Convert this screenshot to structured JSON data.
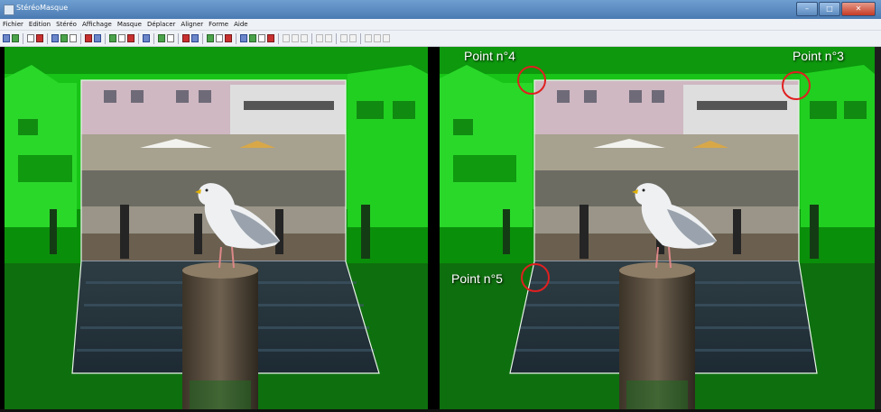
{
  "window": {
    "title": "StéréoMasque",
    "controls": {
      "minimize": "–",
      "maximize": "□",
      "close": "✕"
    }
  },
  "menu": [
    "Fichier",
    "Edition",
    "Stéréo",
    "Affichage",
    "Masque",
    "Déplacer",
    "Aligner",
    "Forme",
    "Aide"
  ],
  "toolbar_icons": [
    "open-icon",
    "save-icon",
    "sep",
    "compare-icon",
    "swap-icon",
    "sep",
    "info-icon",
    "undo-icon",
    "redo-icon",
    "sep",
    "crop-icon",
    "grid-icon",
    "sep",
    "move-icon",
    "scale-icon",
    "align-icon",
    "sep",
    "reset-icon",
    "sep",
    "mask-green-icon",
    "mask-blue-icon",
    "sep",
    "flag-icon",
    "cut-icon",
    "sep",
    "add-point-icon",
    "draw-icon",
    "fill-icon",
    "sep",
    "shape1-icon",
    "shape2-icon",
    "shape3-icon",
    "shape4-icon",
    "sep",
    "shape5-icon",
    "shape6-icon",
    "shape7-icon",
    "sep",
    "shape8-icon",
    "shape9-icon",
    "sep",
    "shape10-icon",
    "shape11-icon",
    "sep",
    "shape12-icon",
    "shape13-icon",
    "shape14-icon"
  ],
  "annotations": {
    "point3": "Point n°3",
    "point4": "Point n°4",
    "point5": "Point n°5"
  },
  "colors": {
    "mask_green": "#14d614",
    "mask_outline": "#e8f5e8",
    "marker_red": "#e02020",
    "title_bar": "#5a8bc4"
  }
}
